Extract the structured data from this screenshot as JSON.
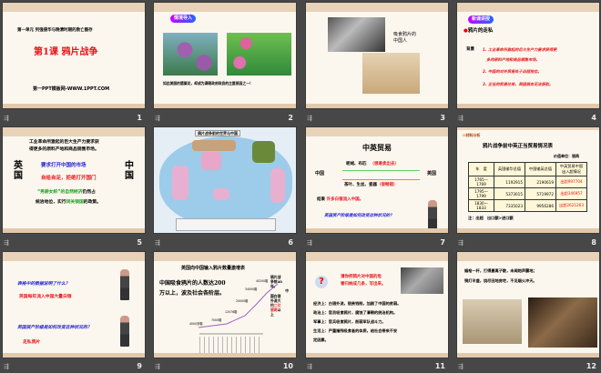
{
  "slides": [
    {
      "number": "1",
      "unit": "第一单元 列强侵华与晚清时期的救亡图存",
      "title": "第1课 鸦片战争",
      "site": "第一PPT模板网-WWW.1PPT.COM"
    },
    {
      "number": "2",
      "tag": "情境导入",
      "caption": "如此美丽的罂粟花，却成为满朝政府政衰的主要原因之一！"
    },
    {
      "number": "3",
      "caption": "吸食鸦片的中国人"
    },
    {
      "number": "4",
      "tag": "新课讲授",
      "heading": "鸦片的走私",
      "label": "背景",
      "points": [
        "1. 工业革命所激起的巨大生产力要求获得更",
        "多的原料产地和商品销售市场。",
        "2. 中国的对外贸易处于出超地位。",
        "3. 正当的贸易往来，英国根本无法获取。"
      ]
    },
    {
      "number": "5",
      "intro": [
        "工业革命所激起的巨大生产力要求获",
        "得更多的原料产地和商品销售市场。"
      ],
      "left": "英国",
      "right": "中国",
      "line1": "要求打开中国的市场",
      "line2": "自给自足，拒绝打开国门",
      "line3a": "“男耕女织”的自然经济",
      "line3b": "仍然占",
      "line4a": "统治地位，实行",
      "line4b": "闭关锁国",
      "line4c": "的政策。"
    },
    {
      "number": "6",
      "map_title": "鸦片战争前的世界与中国"
    },
    {
      "number": "7",
      "title": "中英贸易",
      "top_goods": "呢绒、布匹",
      "top_note": "（很难卖出去）",
      "left": "中国",
      "right": "英国",
      "bottom_goods": "茶叶、生丝、瓷器",
      "bottom_note": "（很畅销）",
      "result_label": "结果",
      "result": "许多白银流入中国。",
      "question": "英国资产阶级是如何改变这种状况的？"
    },
    {
      "number": "8",
      "logo": "材料分析",
      "title": "鸦片战争前中英正当贸易情况表",
      "unit": "价值单位：银两",
      "headers": [
        "年　度",
        "英国输华总值",
        "中国输英总值",
        "中英贸易中国出入超情况"
      ],
      "rows": [
        [
          "1765—1769",
          "1192915",
          "2190619",
          "出超997704"
        ],
        [
          "1795—1799",
          "5373015",
          "5719972",
          "出超346957"
        ],
        [
          "1830—1833",
          "7335023",
          "9956286",
          "出超2621263"
        ]
      ],
      "note": "注：出超　出口额>进口额"
    },
    {
      "number": "9",
      "q1": "表格中的数据说明了什么？",
      "a1": "英国每年流入中国大量白银",
      "q2": "英国资产阶级是如何改变这种状况的？",
      "a2": "走私鸦片"
    },
    {
      "number": "10",
      "title": "英国向中国输入鸦片数量激增表",
      "text1": "中国吸食鸦片的人数达200",
      "text2": "万以上，波及社会各阶层。",
      "points": [
        "4000多箱",
        "7000箱",
        "12076箱",
        "20000箱",
        "34000箱",
        "40200箱"
      ],
      "side": [
        "鸦片战",
        "争前40",
        "年，",
        "中",
        "国白银",
        "外流大",
        "约",
        "二亿",
        "银两",
        "以",
        "上"
      ]
    },
    {
      "number": "11",
      "prompt": [
        "请你把鸦片对中国的危",
        "害归纳成几条，写出来。"
      ],
      "effects": [
        "经济上：白银外流，银贵钱贱，加剧了中国的贫弱。",
        "政治上：官员吸食鸦片，腐蚀了清朝的统治机构。",
        "军事上：官兵吸食鸦片，削弱军队战斗力。",
        "生活上：严重摧残吸食者的体质，给社会带来不安",
        "定因素。"
      ]
    },
    {
      "number": "12",
      "poem": [
        "烟枪一杆，打得妻离子散，未闻炮声震地；",
        "铜灯半盏，烧尽田地房宅，不见烟火冲天。"
      ]
    }
  ],
  "transition_icon": "slide-transition-icon"
}
